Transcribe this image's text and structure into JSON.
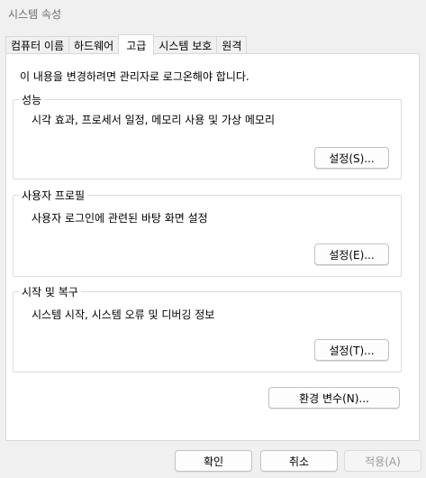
{
  "window": {
    "title": "시스템 속성"
  },
  "tabs": [
    {
      "label": "컴퓨터 이름",
      "active": false
    },
    {
      "label": "하드웨어",
      "active": false
    },
    {
      "label": "고급",
      "active": true
    },
    {
      "label": "시스템 보호",
      "active": false
    },
    {
      "label": "원격",
      "active": false
    }
  ],
  "notice": "이 내용을 변경하려면 관리자로 로그온해야 합니다.",
  "groups": {
    "performance": {
      "title": "성능",
      "description": "시각 효과, 프로세서 일정, 메모리 사용 및 가상 메모리",
      "button": "설정(S)..."
    },
    "user_profiles": {
      "title": "사용자 프로필",
      "description": "사용자 로그인에 관련된 바탕 화면 설정",
      "button": "설정(E)..."
    },
    "startup_recovery": {
      "title": "시작 및 복구",
      "description": "시스템 시작, 시스템 오류 및 디버깅 정보",
      "button": "설정(T)..."
    }
  },
  "env_button": "환경 변수(N)...",
  "footer": {
    "ok": "확인",
    "cancel": "취소",
    "apply": "적용(A)",
    "apply_enabled": false
  }
}
